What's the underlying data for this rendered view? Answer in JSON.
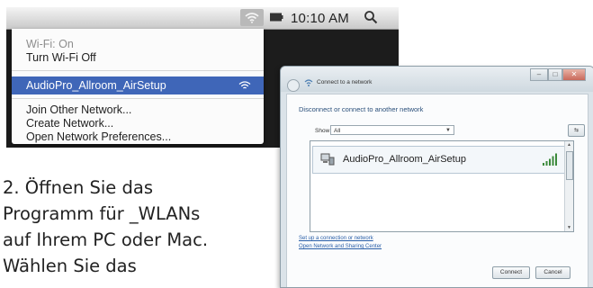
{
  "mac_menu": {
    "clock": "10:10 AM",
    "wifi_status": "Wi-Fi: On",
    "turn_off": "Turn Wi-Fi Off",
    "network": "AudioPro_Allroom_AirSetup",
    "join_other": "Join Other Network...",
    "create": "Create Network...",
    "open_prefs": "Open Network Preferences...",
    "highlight_color": "#3f66b8"
  },
  "win_dialog": {
    "title": "Connect to a network",
    "heading": "Disconnect or connect to another network",
    "show_label": "Show",
    "show_value": "All",
    "network_name": "AudioPro_Allroom_AirSetup",
    "link_setup": "Set up a connection or network",
    "link_center": "Open Network and Sharing Center",
    "connect_button": "Connect",
    "cancel_button": "Cancel",
    "heading_color": "#2a4f7a"
  },
  "instruction": {
    "line1": "2. Öffnen Sie das",
    "line2": "Programm für _WLANs",
    "line3": "auf Ihrem PC oder Mac.",
    "line4": "Wählen Sie das"
  }
}
